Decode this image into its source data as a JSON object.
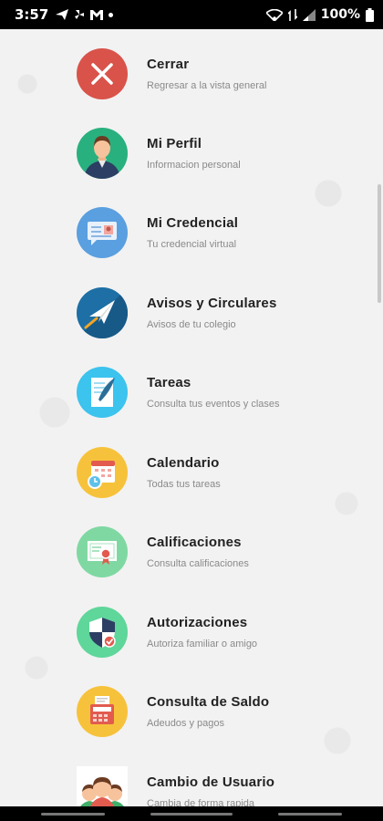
{
  "status_bar": {
    "time": "3:57",
    "battery": "100%",
    "icons": [
      "send-icon",
      "fan-icon",
      "gmail-icon",
      "wifi-icon",
      "data-icon",
      "signal-icon",
      "battery-icon"
    ]
  },
  "menu": {
    "items": [
      {
        "title": "Cerrar",
        "subtitle": "Regresar a la vista general",
        "icon": "close-icon",
        "color": "#d9534a"
      },
      {
        "title": "Mi Perfil",
        "subtitle": "Informacion personal",
        "icon": "profile-icon",
        "color": "#29b07f"
      },
      {
        "title": "Mi Credencial",
        "subtitle": "Tu credencial virtual",
        "icon": "id-card-icon",
        "color": "#5a9fe0"
      },
      {
        "title": "Avisos y Circulares",
        "subtitle": "Avisos de tu colegio",
        "icon": "paper-plane-icon",
        "color": "#1d6fa5"
      },
      {
        "title": "Tareas",
        "subtitle": "Consulta tus eventos y clases",
        "icon": "homework-icon",
        "color": "#3cc3ee"
      },
      {
        "title": "Calendario",
        "subtitle": "Todas tus tareas",
        "icon": "calendar-icon",
        "color": "#f7c23b"
      },
      {
        "title": "Calificaciones",
        "subtitle": "Consulta calificaciones",
        "icon": "certificate-icon",
        "color": "#7fd8a2"
      },
      {
        "title": "Autorizaciones",
        "subtitle": "Autoriza familiar o amigo",
        "icon": "shield-icon",
        "color": "#5fd69a"
      },
      {
        "title": "Consulta de Saldo",
        "subtitle": "Adeudos y pagos",
        "icon": "cash-register-icon",
        "color": "#f7c23b"
      },
      {
        "title": "Cambio de Usuario",
        "subtitle": "Cambia de forma rapida",
        "icon": "switch-user-icon",
        "color": "#ffffff"
      }
    ]
  }
}
